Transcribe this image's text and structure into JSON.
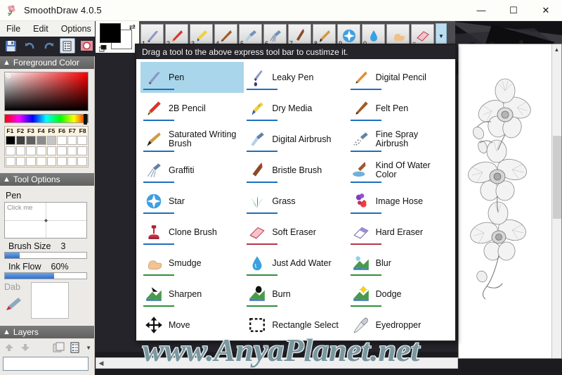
{
  "window": {
    "title": "SmoothDraw 4.0.5",
    "app_icon": "flower-icon",
    "minimize": "—",
    "maximize": "☐",
    "close": "✕"
  },
  "menubar": {
    "items": [
      {
        "label": "File"
      },
      {
        "label": "Edit"
      },
      {
        "label": "Options"
      }
    ]
  },
  "toolbar": {
    "buttons": [
      {
        "name": "save-button",
        "icon": "floppy-disk-icon"
      },
      {
        "name": "undo-button",
        "icon": "undo-arrow-icon"
      },
      {
        "name": "redo-button",
        "icon": "redo-arrow-icon"
      },
      {
        "name": "layer-properties-button",
        "icon": "document-list-icon"
      },
      {
        "name": "record-button",
        "icon": "red-circle-icon"
      }
    ]
  },
  "color_widget": {
    "foreground": "#000000",
    "background": "#ffffff",
    "swap_icon": "swap-arrows-icon",
    "reset_icon": "reset-colors-icon"
  },
  "express_toolbar": {
    "slots": [
      {
        "key": "1",
        "tool": "Pen",
        "icon": "pen-icon"
      },
      {
        "key": "2",
        "tool": "2B Pencil",
        "icon": "pencil-icon"
      },
      {
        "key": "3",
        "tool": "Dry Media",
        "icon": "crayon-icon"
      },
      {
        "key": "4",
        "tool": "Felt Pen",
        "icon": "felt-pen-icon"
      },
      {
        "key": "5",
        "tool": "Digital Airbrush",
        "icon": "airbrush-icon"
      },
      {
        "key": "6",
        "tool": "Graffiti",
        "icon": "graffiti-icon"
      },
      {
        "key": "7",
        "tool": "Bristle Brush",
        "icon": "bristle-brush-icon"
      },
      {
        "key": "8",
        "tool": "Saturated Writing Brush",
        "icon": "saturated-brush-icon"
      },
      {
        "key": "9",
        "tool": "Star",
        "icon": "star-icon"
      },
      {
        "key": "0",
        "tool": "Just Add Water",
        "icon": "water-drop-icon"
      },
      {
        "key": "-",
        "tool": "Smudge",
        "icon": "smudge-finger-icon"
      },
      {
        "key": "=",
        "tool": "Soft Eraser",
        "icon": "eraser-icon"
      }
    ],
    "dropdown_icon": "chevron-down-icon"
  },
  "panels": {
    "foreground_color": {
      "title": "Foreground Color",
      "collapse_icon": "chevron-up-icon",
      "fkeys": [
        "F1",
        "F2",
        "F3",
        "F4",
        "F5",
        "F6",
        "F7",
        "F8"
      ],
      "swatch_row_1": [
        "#000000",
        "#404040",
        "#606060",
        "#8c8c8c",
        "#c4c4c4",
        "#ffffff",
        "#ffffff",
        "#ffffff"
      ],
      "swatch_row_2": [
        "#ffffff",
        "#ffffff",
        "#ffffff",
        "#ffffff",
        "#ffffff",
        "#ffffff",
        "#ffffff",
        "#ffffff"
      ],
      "swatch_row_3": [
        "#ffffff",
        "#ffffff",
        "#ffffff",
        "#ffffff",
        "#ffffff",
        "#ffffff",
        "#ffffff",
        "#ffffff"
      ]
    },
    "tool_options": {
      "title": "Tool Options",
      "collapse_icon": "chevron-up-icon",
      "current_tool": "Pen",
      "preview_hint": "Click me",
      "brush_size_label": "Brush Size",
      "brush_size_value": "3",
      "brush_size_percent": 18,
      "ink_flow_label": "Ink Flow",
      "ink_flow_value": "60%",
      "ink_flow_percent": 60,
      "dab_label": "Dab",
      "dab_icon": "brush-dab-icon"
    },
    "layers": {
      "title": "Layers",
      "collapse_icon": "chevron-up-icon",
      "buttons": [
        {
          "name": "layer-move-up-button",
          "icon": "arrow-up-icon"
        },
        {
          "name": "layer-move-down-button",
          "icon": "arrow-down-icon"
        },
        {
          "name": "layer-properties-button",
          "icon": "layer-properties-icon"
        },
        {
          "name": "layer-menu-button",
          "icon": "list-menu-icon"
        }
      ]
    }
  },
  "tool_palette": {
    "hint": "Drag a tool to the above express tool bar to custimze it.",
    "selected": "Pen",
    "tools": [
      {
        "label": "Pen",
        "icon": "pen-icon",
        "accent": "#1f6fbf"
      },
      {
        "label": "Leaky Pen",
        "icon": "leaky-pen-icon",
        "accent": "#1f6fbf"
      },
      {
        "label": "Digital Pencil",
        "icon": "digital-pencil-icon",
        "accent": "#1f6fbf"
      },
      {
        "label": "2B Pencil",
        "icon": "2b-pencil-icon",
        "accent": "#1f6fbf"
      },
      {
        "label": "Dry Media",
        "icon": "dry-media-icon",
        "accent": "#1f6fbf"
      },
      {
        "label": "Felt Pen",
        "icon": "felt-pen-icon",
        "accent": "#1f6fbf"
      },
      {
        "label": "Saturated Writing Brush",
        "icon": "saturated-brush-icon",
        "accent": "#1f6fbf"
      },
      {
        "label": "Digital Airbrush",
        "icon": "digital-airbrush-icon",
        "accent": "#1f6fbf"
      },
      {
        "label": "Fine Spray Airbrush",
        "icon": "fine-spray-icon",
        "accent": "#1f6fbf"
      },
      {
        "label": "Graffiti",
        "icon": "graffiti-icon",
        "accent": "#1f6fbf"
      },
      {
        "label": "Bristle Brush",
        "icon": "bristle-brush-icon",
        "accent": "#1f6fbf"
      },
      {
        "label": "Kind Of Water Color",
        "icon": "water-color-icon",
        "accent": "#1f6fbf"
      },
      {
        "label": "Star",
        "icon": "star-icon",
        "accent": "#1f6fbf"
      },
      {
        "label": "Grass",
        "icon": "grass-icon",
        "accent": "#1f6fbf"
      },
      {
        "label": "Image Hose",
        "icon": "image-hose-icon",
        "accent": "#1f6fbf"
      },
      {
        "label": "Clone Brush",
        "icon": "clone-stamp-icon",
        "accent": "#1f6fbf"
      },
      {
        "label": "Soft Eraser",
        "icon": "soft-eraser-icon",
        "accent": "#b5364a"
      },
      {
        "label": "Hard Eraser",
        "icon": "hard-eraser-icon",
        "accent": "#b5364a"
      },
      {
        "label": "Smudge",
        "icon": "smudge-finger-icon",
        "accent": "#2f8f3a"
      },
      {
        "label": "Just Add Water",
        "icon": "water-drop-icon",
        "accent": "#2f8f3a"
      },
      {
        "label": "Blur",
        "icon": "blur-icon",
        "accent": "#2f8f3a"
      },
      {
        "label": "Sharpen",
        "icon": "sharpen-icon",
        "accent": "#2f8f3a"
      },
      {
        "label": "Burn",
        "icon": "burn-icon",
        "accent": "#2f8f3a"
      },
      {
        "label": "Dodge",
        "icon": "dodge-icon",
        "accent": "#2f8f3a"
      },
      {
        "label": "Move",
        "icon": "move-cross-icon",
        "accent": ""
      },
      {
        "label": "Rectangle Select",
        "icon": "rectangle-select-icon",
        "accent": ""
      },
      {
        "label": "Eyedropper",
        "icon": "eyedropper-icon",
        "accent": ""
      }
    ]
  },
  "canvas": {
    "artwork": "orchid-flower-pencil-drawing",
    "scroll_up_icon": "chevron-up-icon",
    "scroll_left_icon": "chevron-left-icon"
  },
  "watermark": {
    "text": "www.AnyaPlanet.net"
  }
}
